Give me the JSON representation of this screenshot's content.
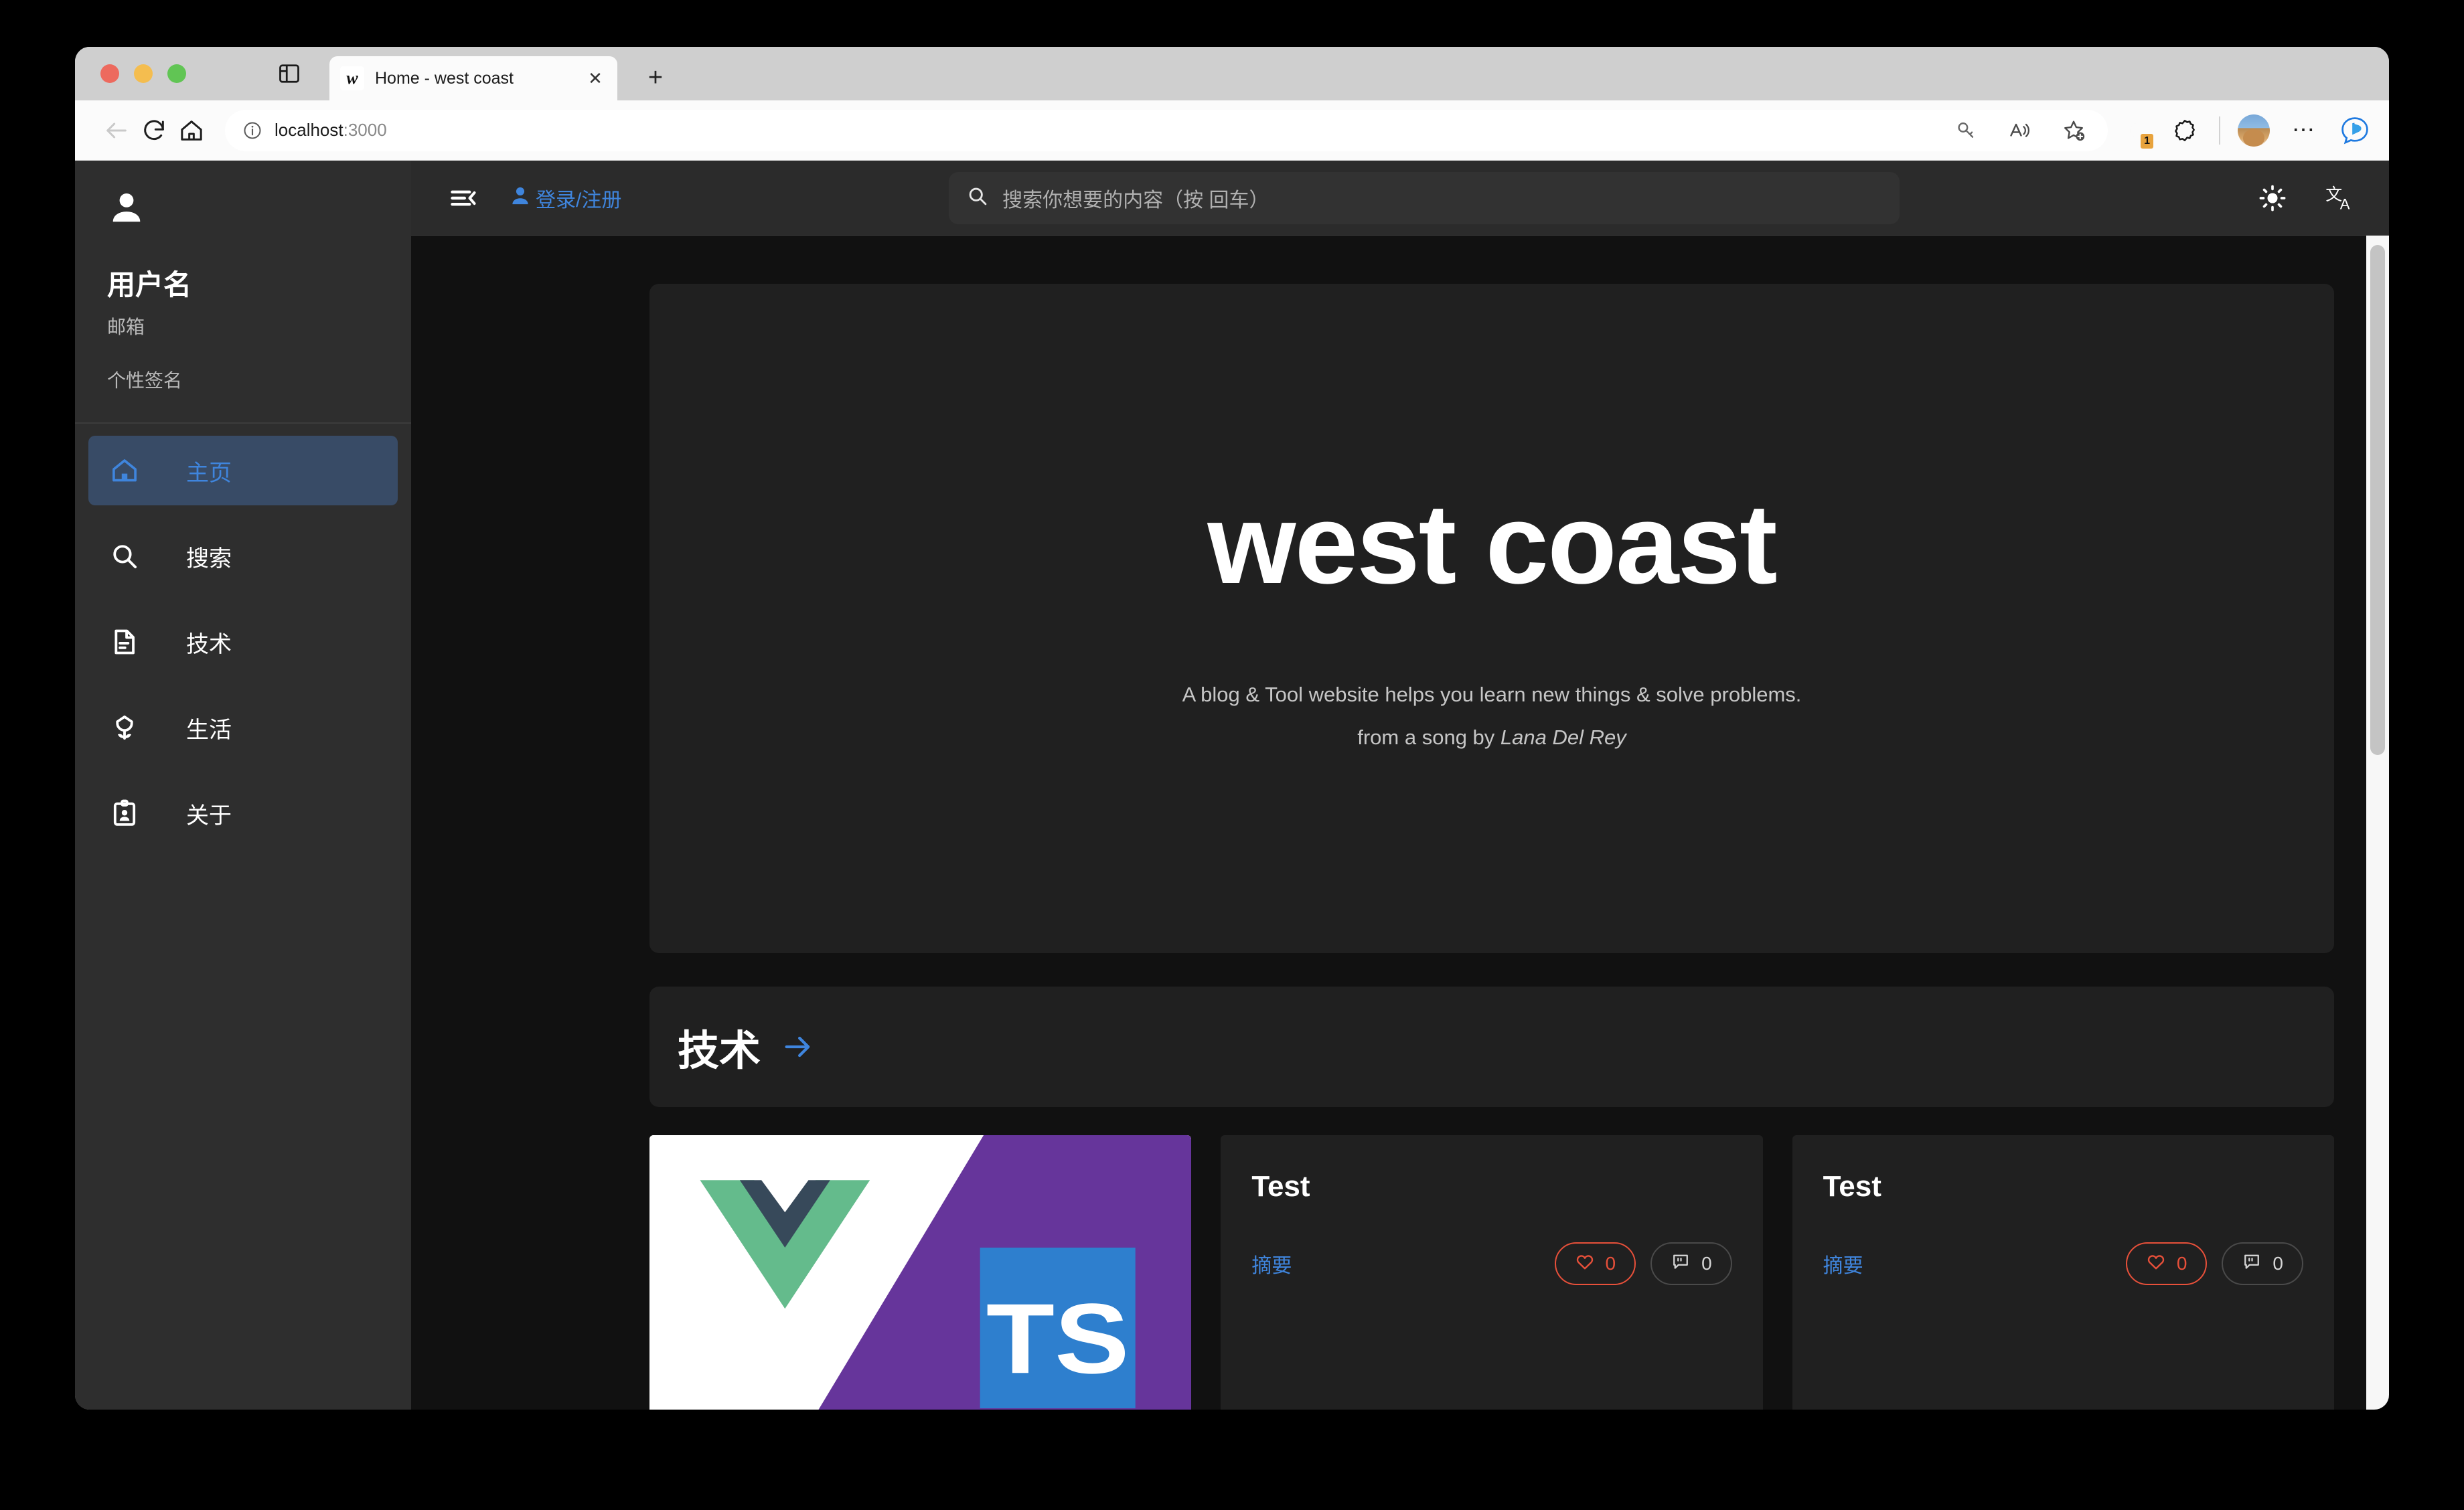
{
  "browser": {
    "traffic_lights": [
      "close",
      "minimize",
      "zoom"
    ],
    "sidebar_toggle_icon": "panel-icon",
    "tab": {
      "favicon_letter": "w",
      "title": "Home - west coast",
      "close_icon": "close-icon"
    },
    "new_tab_label": "+",
    "nav": {
      "back_icon": "back-arrow-icon",
      "reload_icon": "reload-icon",
      "home_icon": "home-icon"
    },
    "omnibox": {
      "info_icon": "info-icon",
      "url_host": "localhost",
      "url_port": ":3000",
      "key_icon": "key-icon",
      "read_aloud_icon": "read-aloud-icon",
      "add_favorite_icon": "add-favorite-icon"
    },
    "toolbar": {
      "extension_badge": "1",
      "extension_icon": "extension-puzzle-icon",
      "collections_icon": "collections-icon",
      "profile_icon": "avatar",
      "settings_more_icon": "more-options-icon",
      "copilot_icon": "bing-copilot-icon"
    }
  },
  "sidebar": {
    "avatar_icon": "person-icon",
    "username": "用户名",
    "email": "邮箱",
    "bio": "个性签名",
    "items": [
      {
        "icon": "home-icon",
        "label": "主页",
        "active": true
      },
      {
        "icon": "search-icon",
        "label": "搜索",
        "active": false
      },
      {
        "icon": "document-icon",
        "label": "技术",
        "active": false
      },
      {
        "icon": "flower-icon",
        "label": "生活",
        "active": false
      },
      {
        "icon": "clipboard-person-icon",
        "label": "关于",
        "active": false
      }
    ]
  },
  "appbar": {
    "menu_icon": "menu-collapse-icon",
    "login_icon": "person-icon",
    "login_label": "登录/注册",
    "search": {
      "icon": "search-icon",
      "placeholder": "搜索你想要的内容（按 回车）",
      "value": ""
    },
    "theme_toggle_icon": "sun-icon",
    "language_icon": "translate-icon"
  },
  "hero": {
    "title": "west coast",
    "subtitle_line1": "A blog & Tool website helps you learn new things & solve problems.",
    "subtitle_line2_prefix": "from a song by ",
    "subtitle_line2_em": "Lana Del Rey"
  },
  "section": {
    "title": "技术",
    "arrow_icon": "arrow-right-icon"
  },
  "cards": [
    {
      "type": "image",
      "image_alt": "vue-typescript-banner",
      "title": "",
      "excerpt": "",
      "likes": "",
      "comments": ""
    },
    {
      "type": "post",
      "title": "Test",
      "excerpt": "摘要",
      "likes": "0",
      "comments": "0",
      "like_icon": "heart-icon",
      "comment_icon": "comment-icon"
    },
    {
      "type": "post",
      "title": "Test",
      "excerpt": "摘要",
      "likes": "0",
      "comments": "0",
      "like_icon": "heart-icon",
      "comment_icon": "comment-icon"
    }
  ],
  "colors": {
    "page_bg": "#111111",
    "sidebar_bg": "#2e2e2e",
    "appbar_bg": "#2b2b2b",
    "card_bg": "#202020",
    "accent_blue": "#3f85dd",
    "like_red": "#e8503a",
    "active_nav_bg": "#384b66"
  }
}
